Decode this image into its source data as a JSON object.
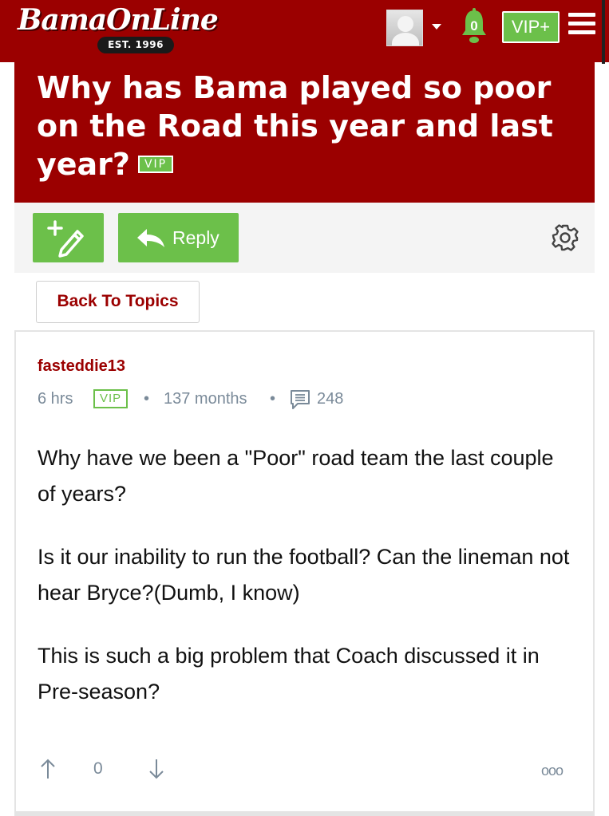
{
  "header": {
    "logo_text": "BamaOnLine",
    "logo_est": "EST. 1996",
    "notification_count": "0",
    "vip_button_label": "VIP+",
    "colors": {
      "brand": "#9b0000",
      "accent": "#6cc04a"
    }
  },
  "thread": {
    "title": "Why has Bama played so poor on the Road this year and last year?",
    "title_badge": "VIP"
  },
  "toolbar": {
    "reply_label": "Reply",
    "icons": [
      "new-post-icon",
      "reply-arrow-icon",
      "gear-icon"
    ]
  },
  "back_button_label": "Back To Topics",
  "post": {
    "author": "fasteddie13",
    "time": "6 hrs",
    "badge": "VIP",
    "member_age": "137 months",
    "post_count": "248",
    "paragraphs": [
      "Why have we been a \"Poor\" road team the last couple of years?",
      "Is it our inability to run the football? Can the lineman not hear Bryce?(Dumb, I know)",
      "This is such a big problem that Coach discussed it in Pre-season?"
    ],
    "vote_count": "0",
    "more_label": "ooo"
  }
}
